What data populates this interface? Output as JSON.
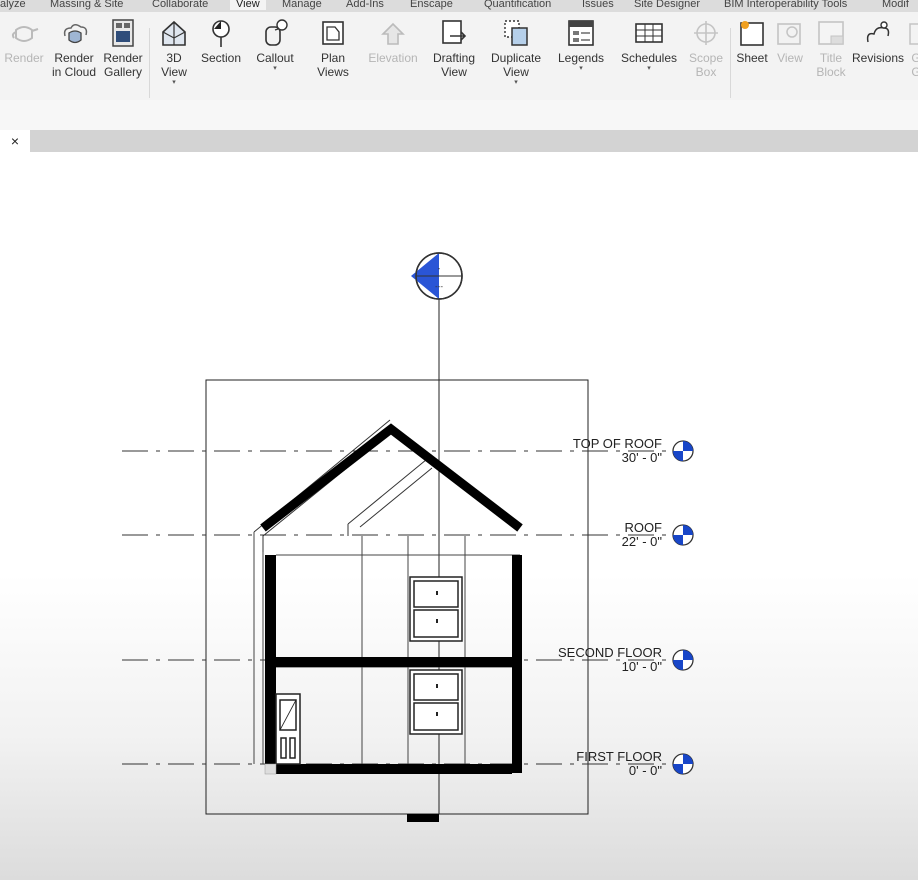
{
  "ribbon_tabs": [
    "alyze",
    "Massing & Site",
    "Collaborate",
    "View",
    "Manage",
    "Add-Ins",
    "Enscape",
    "Quantification",
    "Issues",
    "Site Designer",
    "BIM Interoperability Tools",
    "Modif"
  ],
  "active_tab": "View",
  "ribbon_buttons": {
    "render": {
      "line1": "Render",
      "line2": ""
    },
    "render_cloud": {
      "line1": "Render",
      "line2": "in Cloud"
    },
    "render_gallery": {
      "line1": "Render",
      "line2": "Gallery"
    },
    "view_3d": {
      "line1": "3D",
      "line2": "View"
    },
    "section": {
      "line1": "Section",
      "line2": ""
    },
    "callout": {
      "line1": "Callout",
      "line2": ""
    },
    "plan_views": {
      "line1": "Plan",
      "line2": "Views"
    },
    "elevation": {
      "line1": "Elevation",
      "line2": ""
    },
    "drafting_view": {
      "line1": "Drafting",
      "line2": "View"
    },
    "duplicate_view": {
      "line1": "Duplicate",
      "line2": "View"
    },
    "legends": {
      "line1": "Legends",
      "line2": ""
    },
    "schedules": {
      "line1": "Schedules",
      "line2": ""
    },
    "scope_box": {
      "line1": "Scope",
      "line2": "Box"
    },
    "sheet": {
      "line1": "Sheet",
      "line2": ""
    },
    "view": {
      "line1": "View",
      "line2": ""
    },
    "title_block": {
      "line1": "Title",
      "line2": "Block"
    },
    "revisions": {
      "line1": "Revisions",
      "line2": ""
    },
    "guide_grid": {
      "line1": "G",
      "line2": "G"
    }
  },
  "close_tab": "×",
  "levels": [
    {
      "name": "TOP OF ROOF",
      "elevation": "30' - 0\""
    },
    {
      "name": "ROOF",
      "elevation": "22' - 0\""
    },
    {
      "name": "SECOND FLOOR",
      "elevation": "10' - 0\""
    },
    {
      "name": "FIRST FLOOR",
      "elevation": "0' - 0\""
    }
  ],
  "section_head": {
    "top": "-",
    "bottom": "---"
  },
  "colors": {
    "level_head_blue": "#1846c8",
    "wall": "#000000",
    "accent": "#2a55d6"
  }
}
